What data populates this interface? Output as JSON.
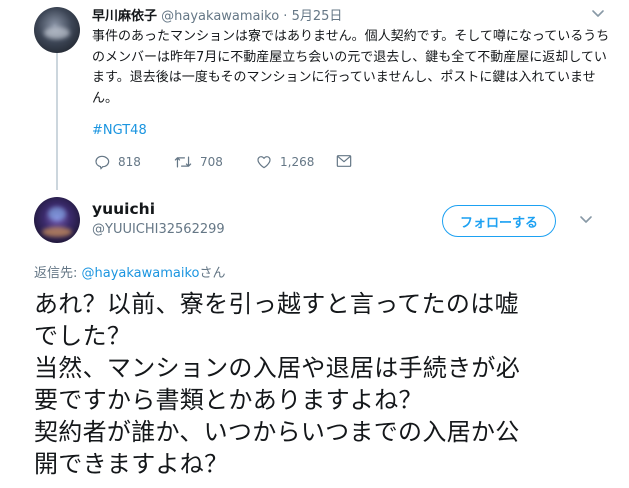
{
  "parent_tweet": {
    "display_name": "早川麻依子",
    "handle": "@hayakawamaiko",
    "separator": "·",
    "date": "5月25日",
    "text": "事件のあったマンションは寮ではありません。個人契約です。そして噂になっているうちのメンバーは昨年7月に不動産屋立ち会いの元で退去し、鍵も全て不動産屋に返却しています。退去後は一度もそのマンションに行っていませんし、ポストに鍵は入れていません。",
    "hashtag": "#NGT48",
    "reply_count": "818",
    "retweet_count": "708",
    "like_count": "1,268"
  },
  "reply_tweet": {
    "display_name": "yuuichi",
    "handle": "@YUUICHI32562299",
    "follow_label": "フォローする",
    "reply_to_prefix": "返信先: ",
    "reply_to_mention": "@hayakawamaiko",
    "reply_to_suffix": "さん",
    "text_lines": [
      "あれ？以前、寮を引っ越すと言ってたのは嘘",
      "でした？",
      "当然、マンションの入居や退居は手続きが必",
      "要ですから書類とかありますよね？",
      "契約者が誰か、いつからいつまでの入居か公",
      "開できますよね？"
    ]
  },
  "colors": {
    "link": "#1b95e0",
    "accent": "#1da1f2",
    "secondary_text": "#657786",
    "primary_text": "#14171a",
    "thread_line": "#ccd6dd"
  },
  "icons": [
    "reply-icon",
    "retweet-icon",
    "like-icon",
    "direct-message-icon",
    "chevron-down-icon"
  ]
}
